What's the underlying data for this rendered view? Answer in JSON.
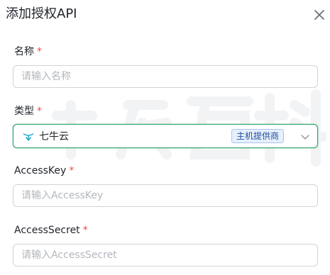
{
  "dialog": {
    "title": "添加授权API"
  },
  "fields": {
    "name": {
      "label": "名称",
      "required_mark": "*",
      "placeholder": "请输入名称"
    },
    "type": {
      "label": "类型",
      "required_mark": "*",
      "selected": "七牛云",
      "badge": "主机提供商",
      "icon": "qiniu-logo-icon"
    },
    "access_key": {
      "label": "AccessKey",
      "required_mark": "*",
      "placeholder": "请输入AccessKey"
    },
    "access_secret": {
      "label": "AccessSecret",
      "required_mark": "*",
      "placeholder": "请输入AccessSecret"
    }
  },
  "colors": {
    "accent": "#31a66d",
    "required": "#f54a45",
    "badge_text": "#1f4fa0",
    "badge_bg": "#e6effc",
    "qiniu_icon": "#2aaad6",
    "input_border": "#d0d3d6"
  }
}
